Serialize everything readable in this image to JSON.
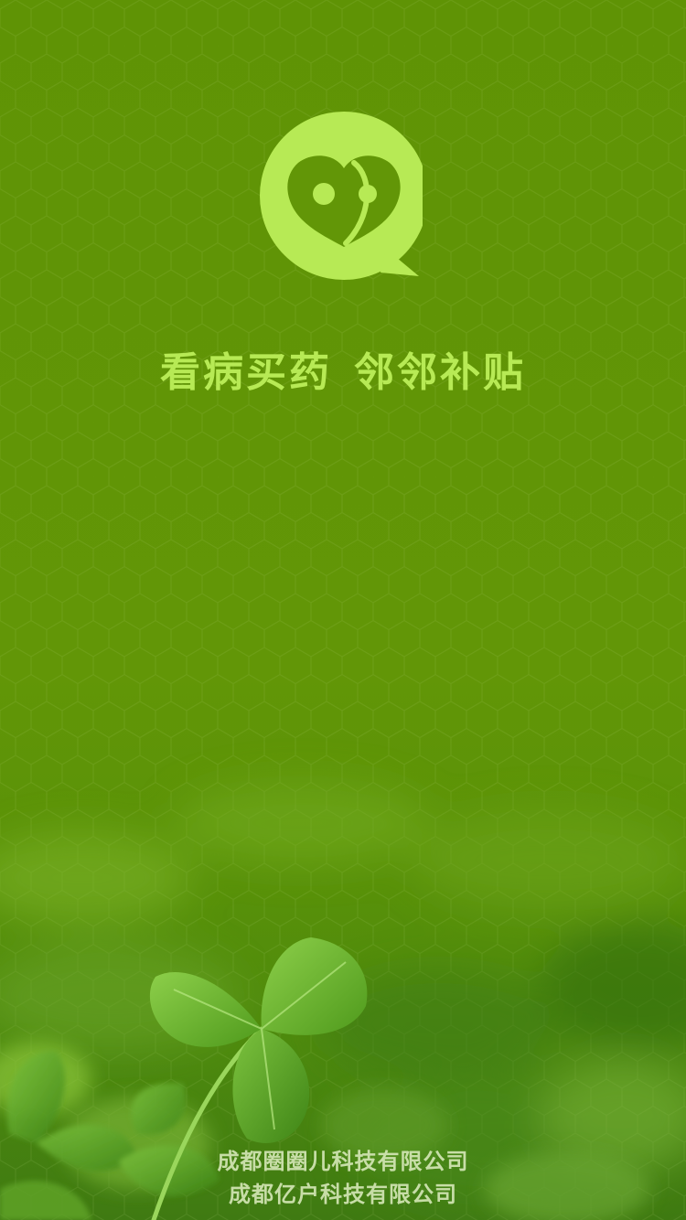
{
  "splash": {
    "slogan_part1": "看病买药",
    "slogan_part2": "邻邻补贴",
    "company_line1": "成都圈圈儿科技有限公司",
    "company_line2": "成都亿户科技有限公司"
  },
  "colors": {
    "background": "#5f9407",
    "accent": "#b7ea55",
    "footer_text": "#d6e8b8"
  },
  "icons": {
    "logo": "chat-bubble-heart-face-icon"
  }
}
